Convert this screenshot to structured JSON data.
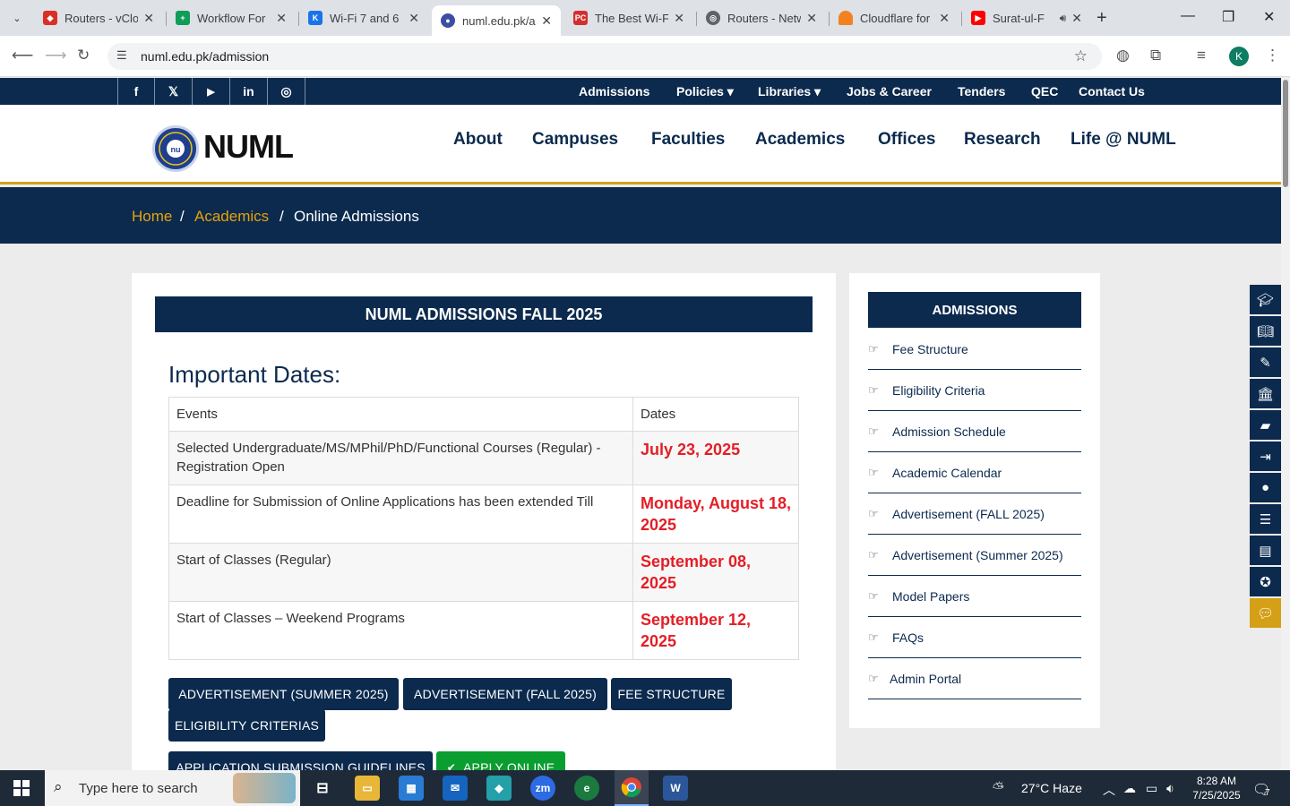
{
  "browser": {
    "tabs": [
      {
        "title": "Routers - vClo",
        "fav_color": "#d93025",
        "x": 0
      },
      {
        "title": "Workflow For",
        "fav_color": "#0f9d58",
        "x": 0
      },
      {
        "title": "Wi-Fi 7 and 6",
        "fav_color": "#1a73e8",
        "x": 0
      },
      {
        "title": "numl.edu.pk/a",
        "fav_color": "#3b4ea3",
        "x": 0
      },
      {
        "title": "The Best Wi-Fi",
        "fav_color": "#d32f2f",
        "x": 0
      },
      {
        "title": "Routers - Netw",
        "fav_color": "#5f6368",
        "x": 0
      },
      {
        "title": "Cloudflare for",
        "fav_color": "#f48120",
        "x": 0
      },
      {
        "title": "Surat-ul-F",
        "fav_color": "#ff0000",
        "x": 0
      }
    ],
    "url": "numl.edu.pk/admission",
    "profile_initial": "K"
  },
  "site": {
    "social": [
      "f",
      "𝕏",
      "▶",
      "in",
      "◎"
    ],
    "top_nav": [
      "Admissions",
      "Policies ▾",
      "Libraries ▾",
      "Jobs & Career",
      "Tenders",
      "QEC",
      "Contact Us"
    ],
    "logo_text": "NUML",
    "main_nav": [
      "About",
      "Campuses",
      "Faculties",
      "Academics",
      "Offices",
      "Research",
      "Life @ NUML"
    ],
    "breadcrumb": {
      "home": "Home",
      "sep": "/",
      "academics": "Academics",
      "current": "Online Admissions"
    }
  },
  "main": {
    "title": "NUML ADMISSIONS FALL 2025",
    "important_dates_title": "Important Dates:",
    "table": {
      "headers": [
        "Events",
        "Dates"
      ],
      "rows": [
        {
          "event": "Selected Undergraduate/MS/MPhil/PhD/Functional Courses (Regular) - Registration Open",
          "date": "July 23, 2025"
        },
        {
          "event": "Deadline for Submission of Online Applications has been extended Till",
          "date": "Monday, August 18, 2025"
        },
        {
          "event": "Start of Classes (Regular)",
          "date": "September 08, 2025"
        },
        {
          "event": "Start of Classes – Weekend Programs",
          "date": "September 12, 2025"
        }
      ]
    },
    "buttons": [
      "ADVERTISEMENT (SUMMER 2025)",
      "ADVERTISEMENT (FALL 2025)",
      "FEE STRUCTURE",
      "ELIGIBILITY CRITERIAS",
      "APPLICATION SUBMISSION GUIDELINES",
      "APPLY ONLINE"
    ]
  },
  "sidebar": {
    "title": "ADMISSIONS",
    "items": [
      "Fee Structure",
      "Eligibility Criteria",
      "Admission Schedule",
      "Academic Calendar",
      "Advertisement (FALL 2025)",
      "Advertisement (Summer 2025)",
      "Model Papers",
      "FAQs",
      "Admin Portal"
    ]
  },
  "taskbar": {
    "search_placeholder": "Type here to search",
    "weather": "27°C  Haze",
    "time": "8:28 AM",
    "date": "7/25/2025",
    "notifications": "7"
  }
}
